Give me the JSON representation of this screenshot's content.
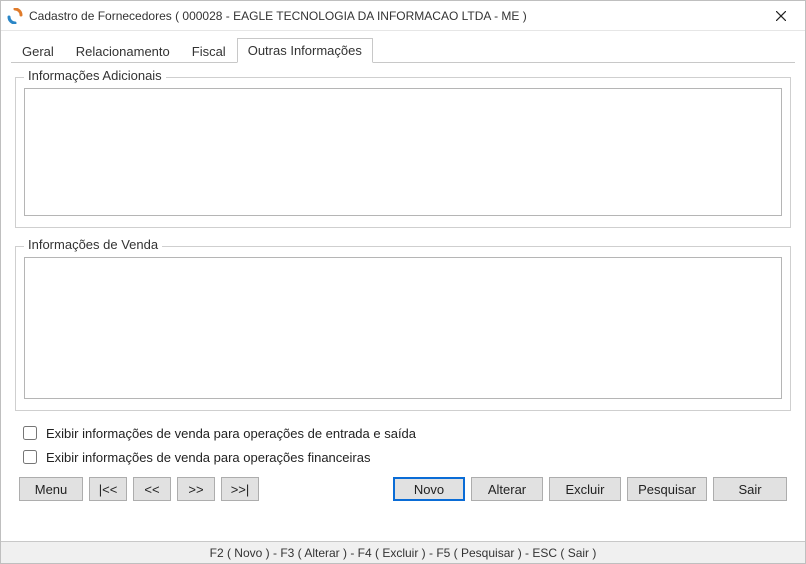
{
  "window": {
    "title": "Cadastro de Fornecedores ( 000028 - EAGLE TECNOLOGIA DA INFORMACAO LTDA - ME )"
  },
  "tabs": {
    "geral": "Geral",
    "relacionamento": "Relacionamento",
    "fiscal": "Fiscal",
    "outras": "Outras Informações"
  },
  "groups": {
    "adicionais": {
      "legend": "Informações Adicionais",
      "value": ""
    },
    "venda": {
      "legend": "Informações de Venda",
      "value": ""
    }
  },
  "checks": {
    "entrada_saida": {
      "label": "Exibir informações de venda para operações de entrada e saída",
      "checked": false
    },
    "financeiras": {
      "label": "Exibir informações de venda para operações financeiras",
      "checked": false
    }
  },
  "buttons": {
    "menu": "Menu",
    "first": "|<<",
    "prev": "<<",
    "next": ">>",
    "last": ">>|",
    "novo": "Novo",
    "alterar": "Alterar",
    "excluir": "Excluir",
    "pesquisar": "Pesquisar",
    "sair": "Sair"
  },
  "status": "F2 ( Novo )  -  F3 ( Alterar )  -  F4 ( Excluir )  -  F5 ( Pesquisar )  -  ESC ( Sair )"
}
